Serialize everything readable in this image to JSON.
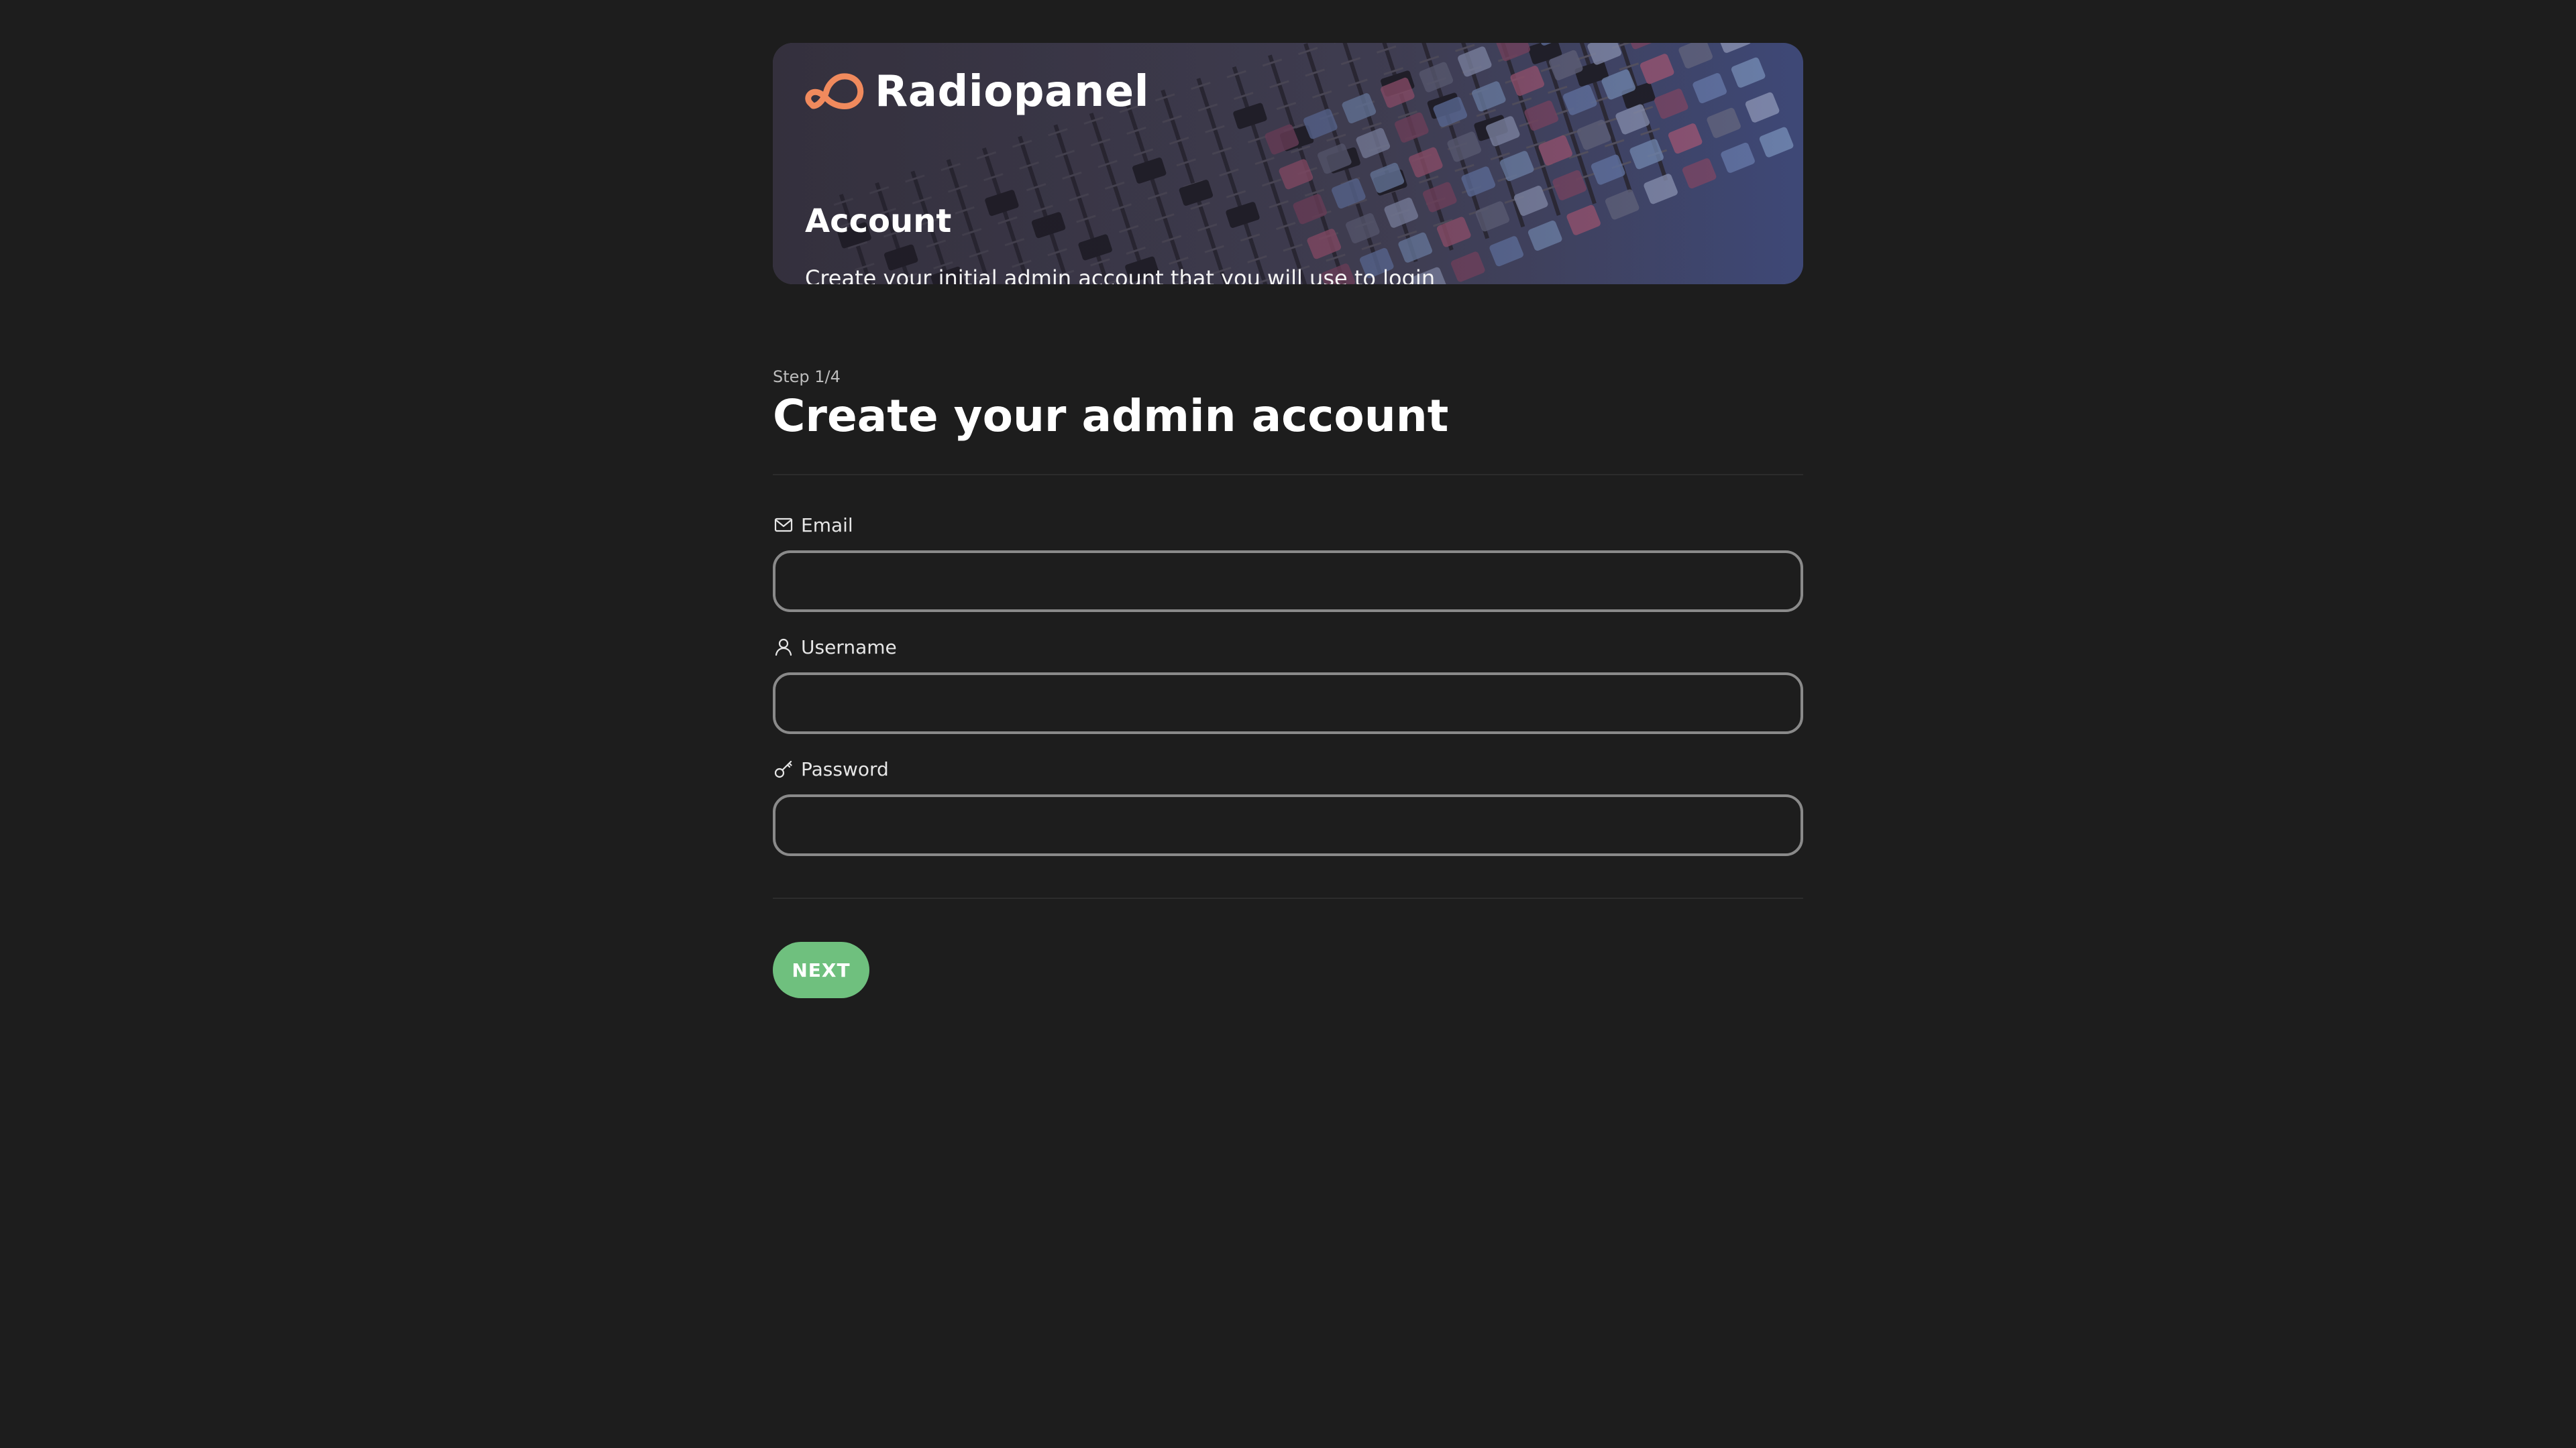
{
  "header": {
    "brand_name": "Radiopanel",
    "title": "Account",
    "subtitle": "Create your initial admin account that you will use to login",
    "logo_icon": "infinity-loop-logo-icon",
    "accent_color": "#f08a5d",
    "mixer_channel_numbers": [
      "17",
      "18",
      "19"
    ]
  },
  "step": {
    "label": "Step 1/4",
    "title": "Create your admin account"
  },
  "form": {
    "fields": [
      {
        "label": "Email",
        "icon": "mail-icon",
        "value": "",
        "placeholder": ""
      },
      {
        "label": "Username",
        "icon": "user-icon",
        "value": "",
        "placeholder": ""
      },
      {
        "label": "Password",
        "icon": "key-icon",
        "value": "",
        "placeholder": ""
      }
    ]
  },
  "actions": {
    "next_label": "NEXT",
    "next_color": "#6fc07e"
  },
  "colors": {
    "background": "#1d1d1d",
    "input_border": "#8a8a8a"
  }
}
